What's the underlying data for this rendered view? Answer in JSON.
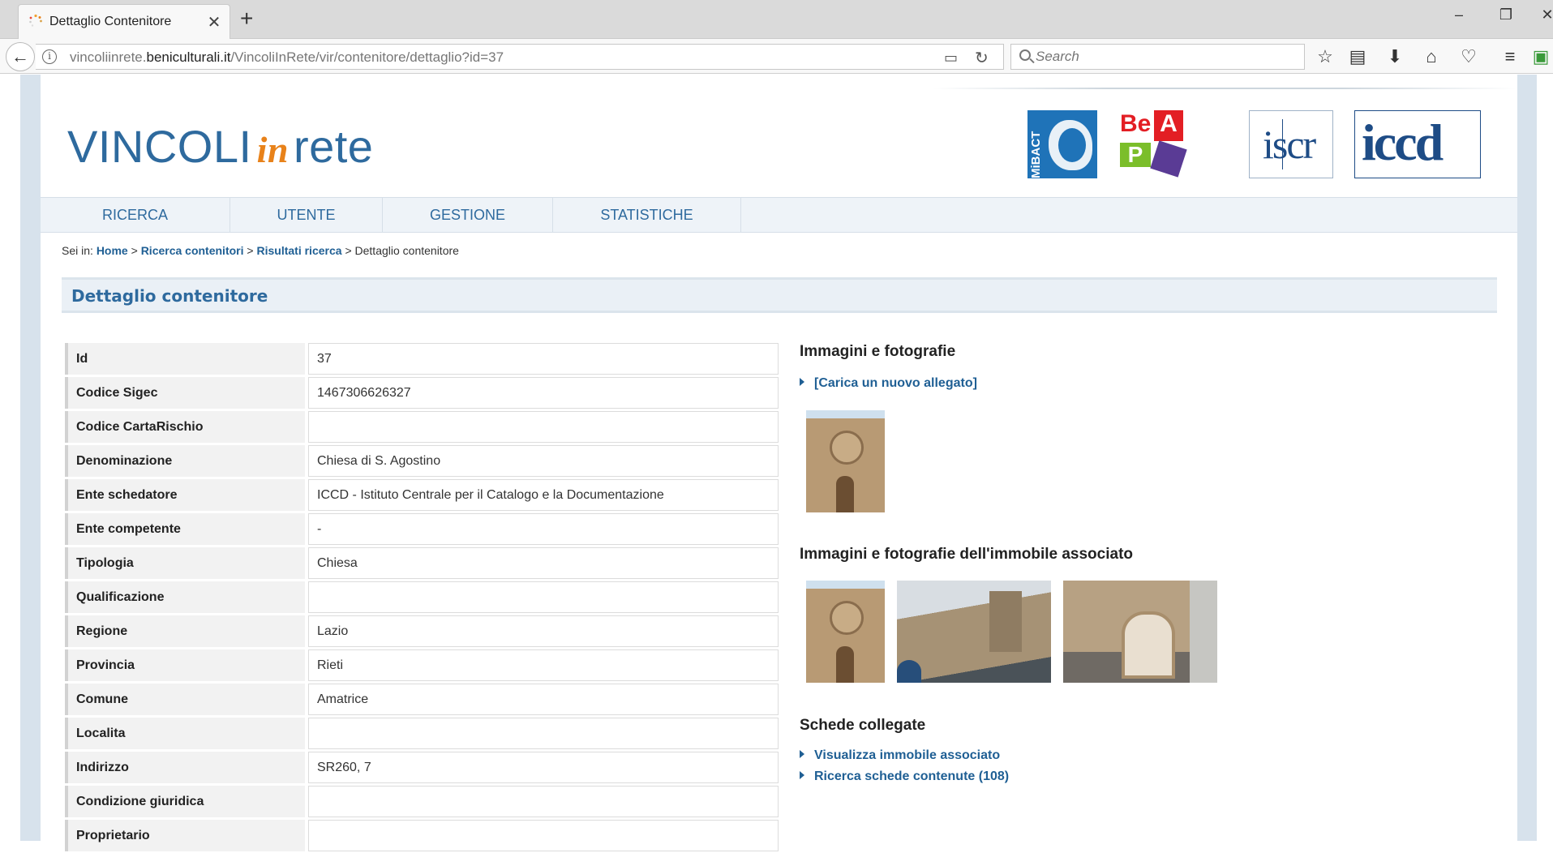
{
  "browser": {
    "tab_title": "Dettaglio Contenitore",
    "url_prefix": "vincoliinrete.",
    "url_domain": "beniculturali.it",
    "url_path": "/VincoliInRete/vir/contenitore/dettaglio?id=37",
    "search_placeholder": "Search"
  },
  "header": {
    "logo_part1": "VINCOLI",
    "logo_part2": "in",
    "logo_part3": "rete",
    "partner_mibac": "MiBACT",
    "partner_bap_r": "Be",
    "partner_bap_a": "A",
    "partner_bap_p": "P",
    "partner_iscr": "iscr",
    "partner_iccd": "iccd"
  },
  "menu": [
    "RICERCA",
    "UTENTE",
    "GESTIONE",
    "STATISTICHE"
  ],
  "breadcrumb": {
    "prefix": "Sei in:",
    "home": "Home",
    "sep": ">",
    "search": "Ricerca contenitori",
    "results": "Risultati ricerca",
    "current": "Dettaglio contenitore"
  },
  "page_title": "Dettaglio contenitore",
  "details": [
    {
      "label": "Id",
      "value": "37"
    },
    {
      "label": "Codice Sigec",
      "value": "1467306626327"
    },
    {
      "label": "Codice CartaRischio",
      "value": ""
    },
    {
      "label": "Denominazione",
      "value": "Chiesa di S. Agostino"
    },
    {
      "label": "Ente schedatore",
      "value": "ICCD - Istituto Centrale per il Catalogo e la Documentazione"
    },
    {
      "label": "Ente competente",
      "value": "-"
    },
    {
      "label": "Tipologia",
      "value": "Chiesa"
    },
    {
      "label": "Qualificazione",
      "value": ""
    },
    {
      "label": "Regione",
      "value": "Lazio"
    },
    {
      "label": "Provincia",
      "value": "Rieti"
    },
    {
      "label": "Comune",
      "value": "Amatrice"
    },
    {
      "label": "Localita",
      "value": ""
    },
    {
      "label": "Indirizzo",
      "value": "SR260, 7"
    },
    {
      "label": "Condizione giuridica",
      "value": ""
    },
    {
      "label": "Proprietario",
      "value": ""
    }
  ],
  "side": {
    "images_title": "Immagini e fotografie",
    "upload_link": "[Carica un nuovo allegato]",
    "assoc_images_title": "Immagini e fotografie dell'immobile associato",
    "linked_title": "Schede collegate",
    "link_view_building": "Visualizza immobile associato",
    "link_search_contents": "Ricerca schede contenute (108)"
  },
  "colors": {
    "brand_blue": "#2e6a9e",
    "logo_orange": "#e8821a",
    "link_blue": "#1f5f94"
  }
}
